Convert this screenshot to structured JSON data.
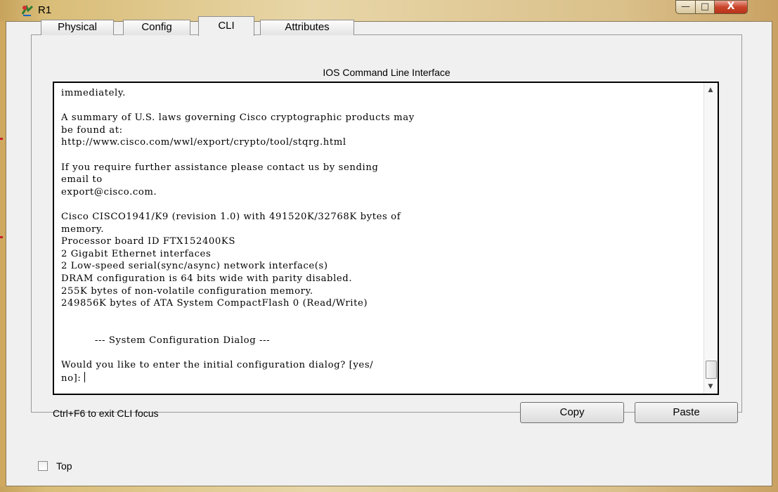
{
  "window": {
    "title": "R1",
    "minimize_glyph": "—",
    "maximize_glyph": "□",
    "close_glyph": "X",
    "icon": "router-app-icon"
  },
  "tabs": [
    {
      "label": "Physical",
      "active": false
    },
    {
      "label": "Config",
      "active": false
    },
    {
      "label": "CLI",
      "active": true
    },
    {
      "label": "Attributes",
      "active": false
    }
  ],
  "cli": {
    "heading": "IOS Command Line Interface",
    "lines": [
      "immediately.",
      "",
      "A summary of U.S. laws governing Cisco cryptographic products may",
      "be found at:",
      "http://www.cisco.com/wwl/export/crypto/tool/stqrg.html",
      "",
      "If you require further assistance please contact us by sending",
      "email to",
      "export@cisco.com.",
      "",
      "Cisco CISCO1941/K9 (revision 1.0) with 491520K/32768K bytes of",
      "memory.",
      "Processor board ID FTX152400KS",
      "2 Gigabit Ethernet interfaces",
      "2 Low-speed serial(sync/async) network interface(s)",
      "DRAM configuration is 64 bits wide with parity disabled.",
      "255K bytes of non-volatile configuration memory.",
      "249856K bytes of ATA System CompactFlash 0 (Read/Write)",
      "",
      "",
      "          --- System Configuration Dialog ---",
      "",
      "Would you like to enter the initial configuration dialog? [yes/"
    ],
    "prompt": "no]: ",
    "focus_hint": "Ctrl+F6 to exit CLI focus"
  },
  "buttons": {
    "copy": "Copy",
    "paste": "Paste"
  },
  "footer": {
    "top_label": "Top",
    "top_checked": false
  },
  "colors": {
    "frame": "#d9bd78",
    "close_button": "#c9452a"
  }
}
